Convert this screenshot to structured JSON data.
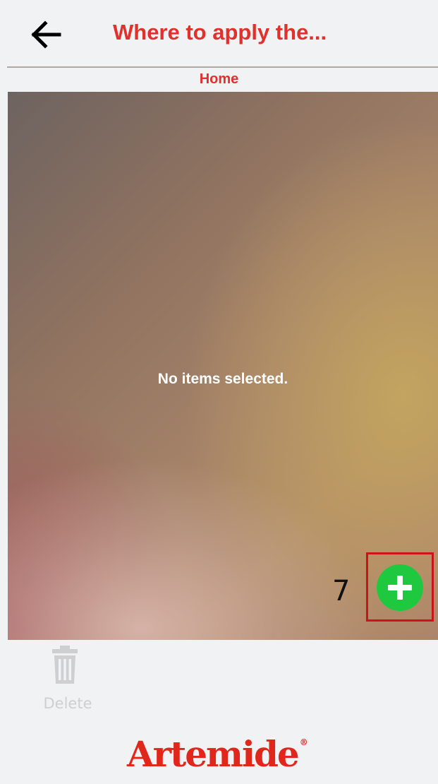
{
  "header": {
    "title": "Where to apply the...",
    "subtitle": "Home",
    "back_icon": "arrow-left-icon"
  },
  "preview": {
    "empty_message": "No items selected."
  },
  "annotation": {
    "index_label": "7"
  },
  "add_button": {
    "icon": "plus-icon",
    "color": "#1ec93f"
  },
  "toolbar": {
    "delete_label": "Delete",
    "delete_icon": "trash-icon"
  },
  "brand": {
    "logo_text": "Artemide",
    "color": "#e1261c"
  },
  "colors": {
    "accent": "#e0312c",
    "annotation_frame": "#c8141a"
  }
}
